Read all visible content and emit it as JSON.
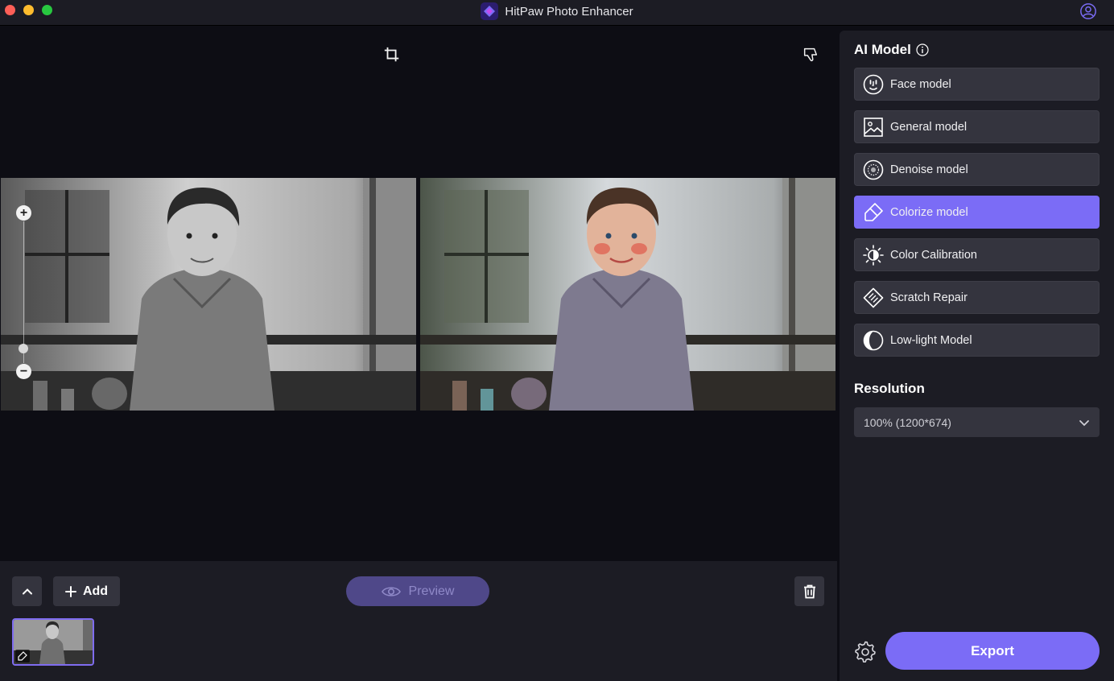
{
  "window": {
    "title": "HitPaw Photo Enhancer"
  },
  "canvas": {
    "zoom_in_symbol": "+",
    "zoom_out_symbol": "−",
    "zoom_level": 0.14
  },
  "panel": {
    "ai_model_title": "AI Model",
    "models": [
      {
        "label": "Face model",
        "icon": "face-icon",
        "active": false
      },
      {
        "label": "General model",
        "icon": "image-icon",
        "active": false
      },
      {
        "label": "Denoise model",
        "icon": "denoise-icon",
        "active": false
      },
      {
        "label": "Colorize model",
        "icon": "colorize-brush-icon",
        "active": true
      },
      {
        "label": "Color Calibration",
        "icon": "sun-icon",
        "active": false
      },
      {
        "label": "Scratch Repair",
        "icon": "scratch-repair-icon",
        "active": false
      },
      {
        "label": "Low-light Model",
        "icon": "half-moon-icon",
        "active": false
      }
    ],
    "resolution_title": "Resolution",
    "resolution_value": "100% (1200*674)",
    "export_label": "Export"
  },
  "bottom": {
    "add_label": "Add",
    "preview_label": "Preview"
  },
  "colors": {
    "accent": "#7b6cf6",
    "panel_bg": "#1c1c24",
    "button_bg": "#34343e",
    "canvas_bg": "#0d0d14"
  }
}
